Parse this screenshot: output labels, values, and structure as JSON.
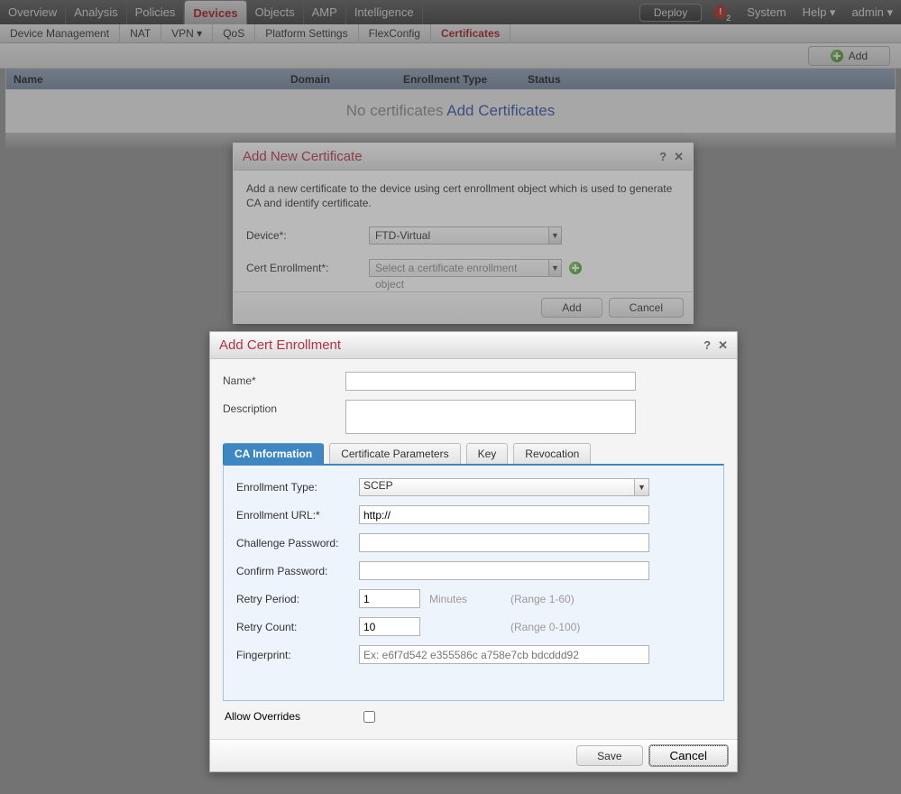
{
  "topnav": {
    "items": [
      "Overview",
      "Analysis",
      "Policies",
      "Devices",
      "Objects",
      "AMP",
      "Intelligence"
    ],
    "active": "Devices",
    "deploy": "Deploy",
    "alert_count": "2",
    "right": {
      "system": "System",
      "help": "Help ▾",
      "user": "admin ▾"
    }
  },
  "subnav": {
    "items": [
      "Device Management",
      "NAT",
      "VPN ▾",
      "QoS",
      "Platform Settings",
      "FlexConfig",
      "Certificates"
    ],
    "active": "Certificates"
  },
  "toolbar": {
    "add": "Add"
  },
  "table": {
    "cols": {
      "name": "Name",
      "domain": "Domain",
      "enrollment_type": "Enrollment Type",
      "status": "Status"
    },
    "empty_prefix": "No certificates ",
    "empty_link": "Add Certificates"
  },
  "modal1": {
    "title": "Add New Certificate",
    "desc": "Add a new certificate to the device using cert enrollment object which is used to generate CA and identify certificate.",
    "device_label": "Device*:",
    "device_value": "FTD-Virtual",
    "cert_label": "Cert Enrollment*:",
    "cert_placeholder": "Select a certificate enrollment object",
    "add": "Add",
    "cancel": "Cancel"
  },
  "modal2": {
    "title": "Add Cert Enrollment",
    "name_label": "Name*",
    "desc_label": "Description",
    "tabs": {
      "ca": "CA Information",
      "params": "Certificate Parameters",
      "key": "Key",
      "rev": "Revocation"
    },
    "form": {
      "enroll_type_label": "Enrollment Type:",
      "enroll_type_value": "SCEP",
      "enroll_url_label": "Enrollment URL:*",
      "enroll_url_value": "http://",
      "chal_pw_label": "Challenge Password:",
      "conf_pw_label": "Confirm Password:",
      "retry_period_label": "Retry Period:",
      "retry_period_value": "1",
      "retry_period_unit": "Minutes",
      "retry_period_hint": "(Range 1-60)",
      "retry_count_label": "Retry Count:",
      "retry_count_value": "10",
      "retry_count_hint": "(Range 0-100)",
      "fingerprint_label": "Fingerprint:",
      "fingerprint_placeholder": "Ex: e6f7d542 e355586c a758e7cb bdcddd92"
    },
    "allow_overrides": "Allow Overrides",
    "save": "Save",
    "cancel": "Cancel"
  }
}
